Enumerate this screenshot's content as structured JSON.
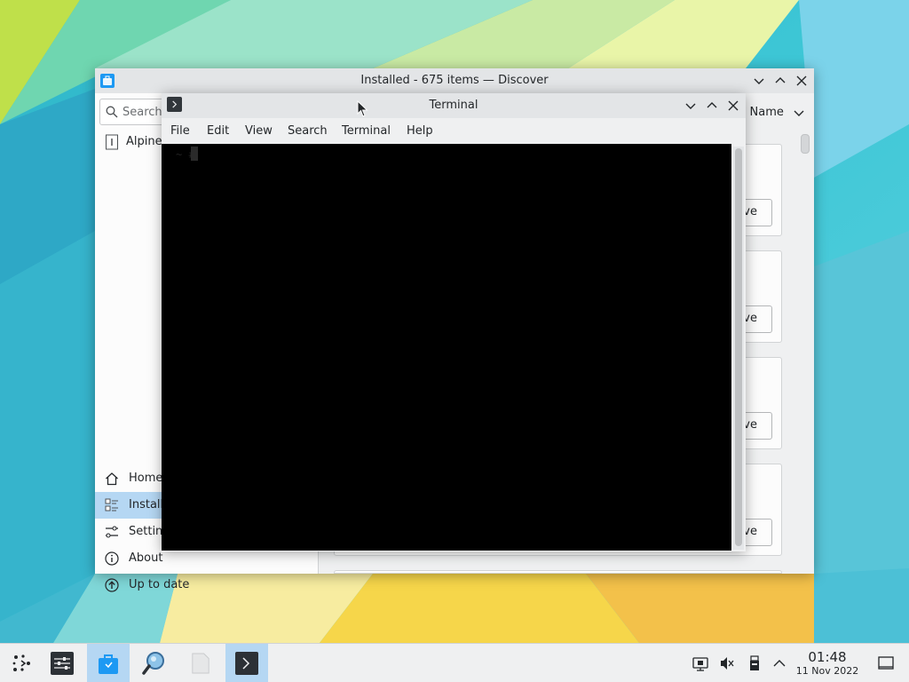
{
  "colors": {
    "accent": "#1d99f3",
    "selection": "#b5d7f3",
    "window_bg": "#eff0f1",
    "terminal_bg": "#000000"
  },
  "discover": {
    "title": "Installed - 675 items — Discover",
    "search_placeholder": "Search",
    "top_item": "Alpine",
    "sort_label": ": Name",
    "nav": [
      {
        "label": "Home",
        "icon": "home-icon"
      },
      {
        "label": "Installe",
        "icon": "installed-icon"
      },
      {
        "label": "Setting",
        "icon": "settings-icon"
      },
      {
        "label": "About",
        "icon": "info-icon"
      },
      {
        "label": "Up to date",
        "icon": "update-icon"
      }
    ],
    "card_button_label": "ve"
  },
  "terminal": {
    "title": "Terminal",
    "menu": [
      "File",
      "Edit",
      "View",
      "Search",
      "Terminal",
      "Help"
    ],
    "prompt": "~ #"
  },
  "taskbar": {
    "apps": [
      {
        "icon": "application-launcher-icon",
        "active": false
      },
      {
        "icon": "system-settings-icon",
        "active": false
      },
      {
        "icon": "discover-icon",
        "active": true
      },
      {
        "icon": "magnifier-icon",
        "active": false
      },
      {
        "icon": "file-icon",
        "active": false
      },
      {
        "icon": "terminal-icon",
        "active": true
      }
    ],
    "clock_time": "01:48",
    "clock_date": "11 Nov 2022"
  }
}
